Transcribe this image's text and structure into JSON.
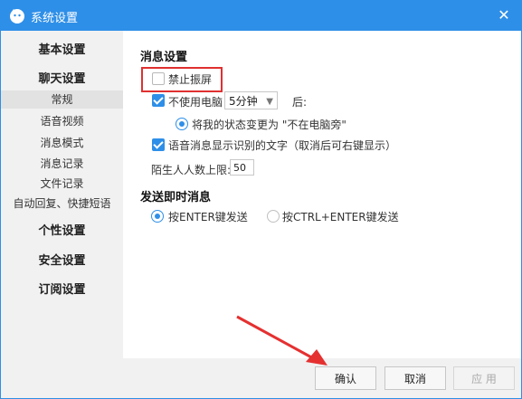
{
  "window": {
    "title": "系统设置",
    "close_glyph": "✕"
  },
  "sidebar": {
    "items": [
      {
        "label": "基本设置"
      },
      {
        "label": "聊天设置"
      },
      {
        "label": "常规"
      },
      {
        "label": "语音视频"
      },
      {
        "label": "消息模式"
      },
      {
        "label": "消息记录"
      },
      {
        "label": "文件记录"
      },
      {
        "label": "自动回复、快捷短语"
      },
      {
        "label": "个性设置"
      },
      {
        "label": "安全设置"
      },
      {
        "label": "订阅设置"
      }
    ]
  },
  "message_settings": {
    "title": "消息设置",
    "disable_shake": {
      "label": "禁止振屏",
      "checked": false
    },
    "idle": {
      "label": "不使用电脑",
      "checked": true,
      "duration_value": "5分钟",
      "after_label": "后:",
      "status_option": "将我的状态变更为 \"不在电脑旁\"",
      "status_selected": true
    },
    "voice_text": {
      "label": "语音消息显示识别的文字（取消后可右键显示）",
      "checked": true
    },
    "stranger_limit": {
      "label": "陌生人人数上限:",
      "value": "50"
    }
  },
  "send_settings": {
    "title": "发送即时消息",
    "options": [
      {
        "label": "按ENTER键发送",
        "selected": true
      },
      {
        "label": "按CTRL+ENTER键发送",
        "selected": false
      }
    ]
  },
  "footer": {
    "confirm": "确认",
    "cancel": "取消",
    "apply": "应 用"
  },
  "colors": {
    "accent": "#2e8fe8",
    "highlight": "#e03030"
  }
}
